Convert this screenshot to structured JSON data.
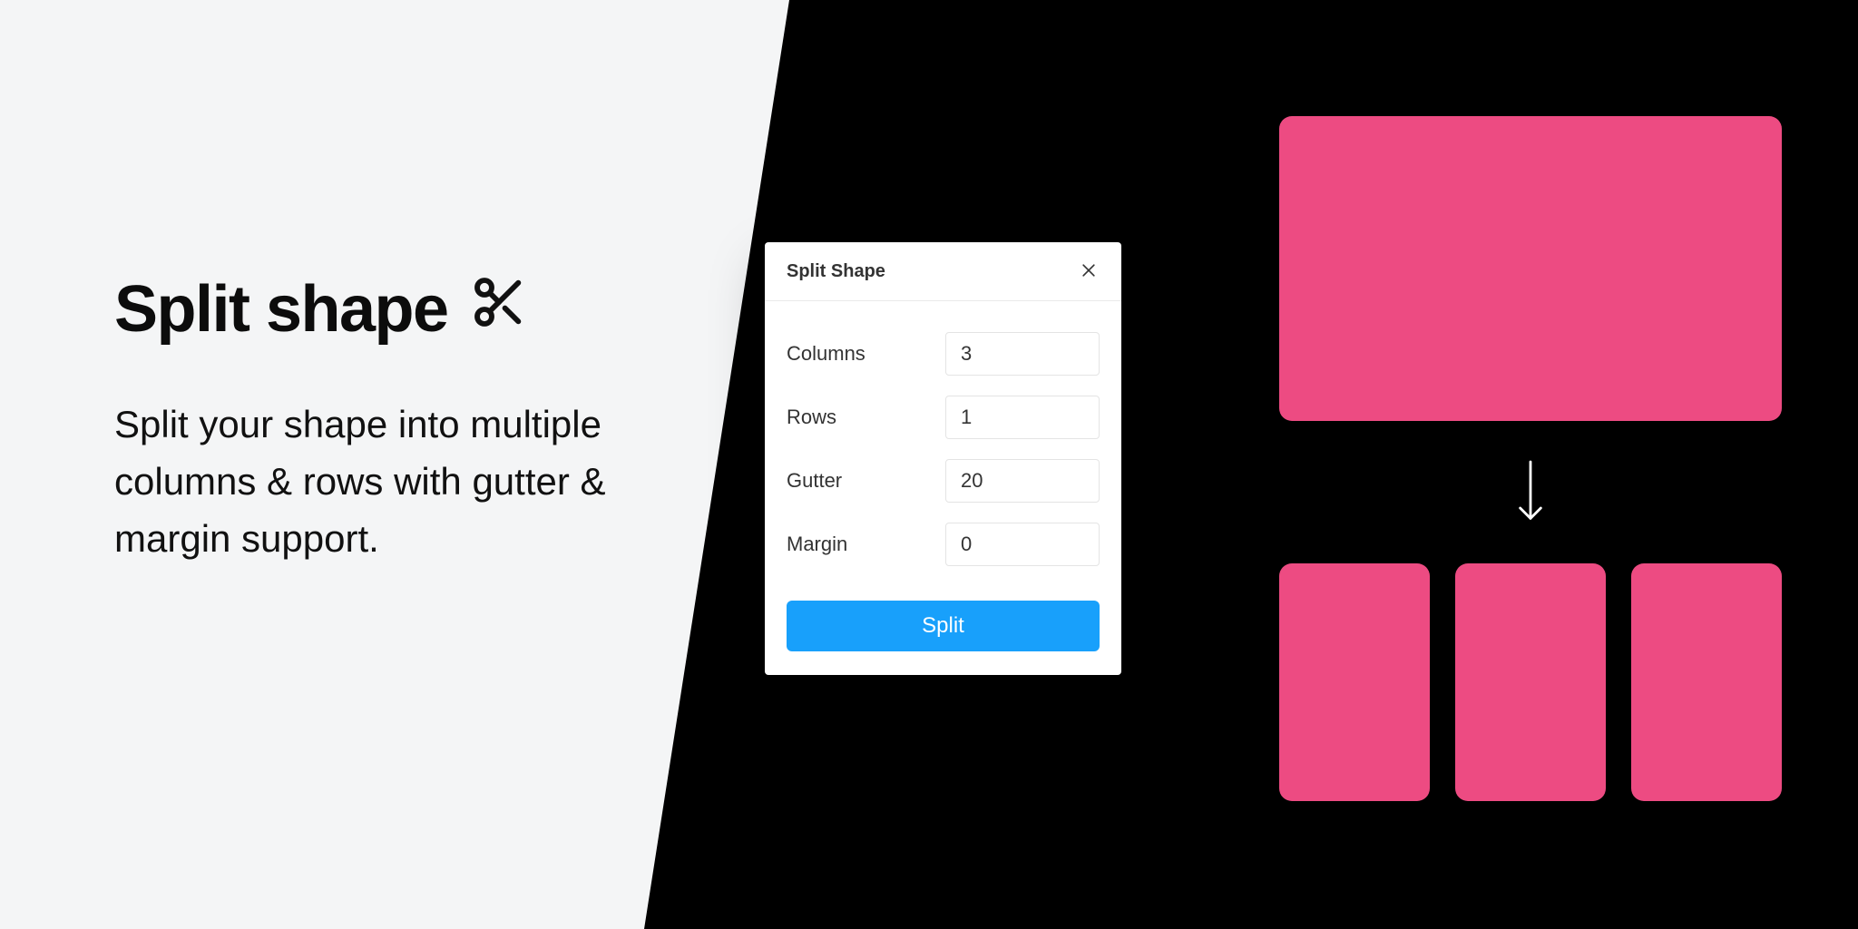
{
  "promo": {
    "title": "Split shape",
    "description": "Split your shape into multiple columns & rows with gutter & margin support."
  },
  "panel": {
    "title": "Split Shape",
    "fields": {
      "columns": {
        "label": "Columns",
        "value": "3"
      },
      "rows": {
        "label": "Rows",
        "value": "1"
      },
      "gutter": {
        "label": "Gutter",
        "value": "20"
      },
      "margin": {
        "label": "Margin",
        "value": "0"
      }
    },
    "submit_label": "Split"
  },
  "colors": {
    "accent": "#18a0fb",
    "shape": "#ed4b82"
  }
}
